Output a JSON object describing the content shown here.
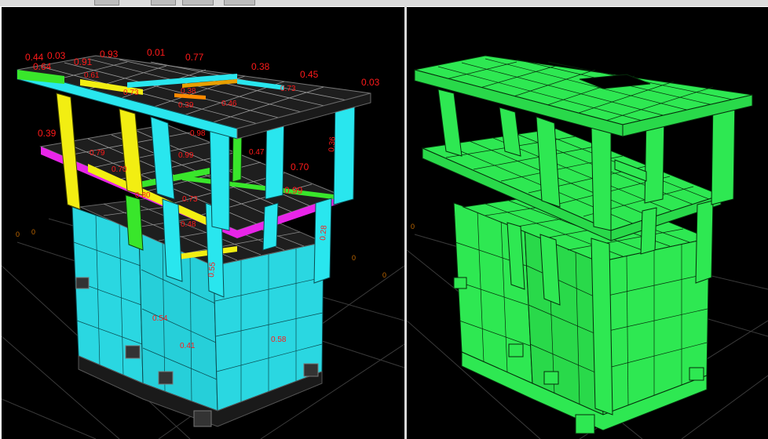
{
  "left_view": {
    "ratio_labels": [
      "0.44",
      "0.03",
      "0.64",
      "0.91",
      "0.93",
      "0.01",
      "0.77",
      "0.38",
      "0.45",
      "0.03",
      "0.61",
      "0.39",
      "0.70",
      "0.99",
      "0.98",
      "0.99",
      "0.70",
      "0.73",
      "0.47",
      "0.79",
      "0.36",
      "0.28",
      "0.39",
      "0.38",
      "0.73",
      "0.80",
      "0.73",
      "0.46",
      "0.48",
      "0.58",
      "0.41",
      "0.54",
      "0.55"
    ],
    "colors": {
      "column": "#29e6ee",
      "beam_yellow": "#f2ee12",
      "beam_magenta": "#e825e8",
      "beam_green": "#39e62b",
      "slab": "#222222",
      "wall": "#2ad7e1",
      "label": "#ff1a1a"
    }
  },
  "right_view": {
    "colors": {
      "structure": "#2ee852",
      "outline": "#062b0b"
    }
  },
  "axes": {
    "markers": [
      "0",
      "0",
      "0",
      "0",
      "0"
    ]
  }
}
